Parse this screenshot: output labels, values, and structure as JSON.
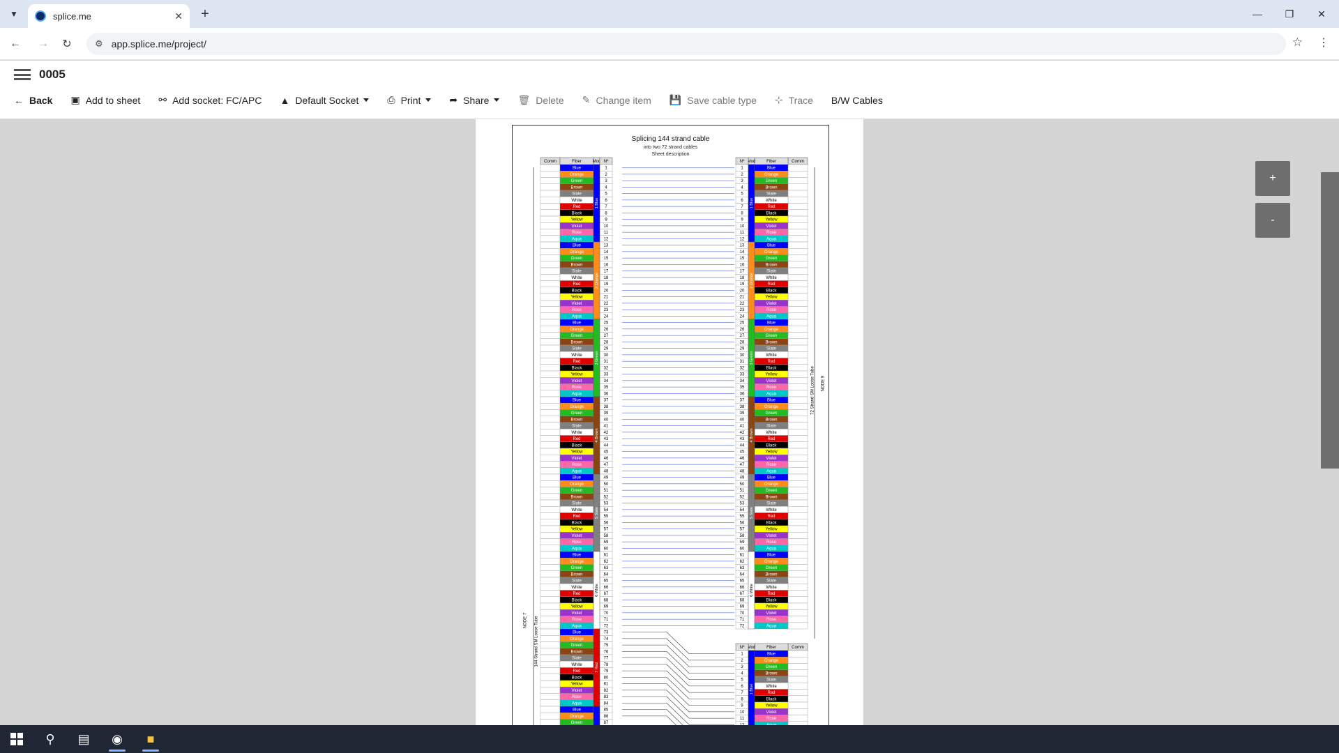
{
  "browser": {
    "tab_title": "splice.me",
    "url": "app.splice.me/project/"
  },
  "app": {
    "title": "0005",
    "actions": {
      "back": "Back",
      "add_to_sheet": "Add to sheet",
      "add_socket": "Add socket: FC/APC",
      "default_socket": "Default Socket",
      "print": "Print",
      "share": "Share",
      "delete": "Delete",
      "change_item": "Change item",
      "save_cable_type": "Save cable type",
      "trace": "Trace",
      "bw_cables": "B/W Cables"
    }
  },
  "sheet": {
    "title": "Splicing 144 strand cable",
    "subtitle": "into two 72 strand cables",
    "description": "Sheet description",
    "headers": {
      "comm": "Comm",
      "fiber": "Fiber",
      "mod": "Mod",
      "num": "Nº"
    },
    "left_cable_label": "144 Strand SM Loose Tube",
    "left_node_label": "NODE 7",
    "right_cable_label": "72 Strand SM Loose Tube",
    "right_node_label": "NODE 9",
    "fiber_colors": [
      {
        "name": "Blue",
        "bg": "#0000ff",
        "fg": "#ffffff"
      },
      {
        "name": "Orange",
        "bg": "#ff8c1a",
        "fg": "#ffffff"
      },
      {
        "name": "Green",
        "bg": "#22bb22",
        "fg": "#ffffff"
      },
      {
        "name": "Brown",
        "bg": "#8b4513",
        "fg": "#ffffff"
      },
      {
        "name": "Slate",
        "bg": "#808080",
        "fg": "#ffffff"
      },
      {
        "name": "White",
        "bg": "#ffffff",
        "fg": "#000000"
      },
      {
        "name": "Red",
        "bg": "#e00000",
        "fg": "#ffffff"
      },
      {
        "name": "Black",
        "bg": "#000000",
        "fg": "#ffffff"
      },
      {
        "name": "Yellow",
        "bg": "#ffff00",
        "fg": "#000000"
      },
      {
        "name": "Violet",
        "bg": "#9933cc",
        "fg": "#ffffff"
      },
      {
        "name": "Rose",
        "bg": "#ff66aa",
        "fg": "#ffffff"
      },
      {
        "name": "Aqua",
        "bg": "#00c8c8",
        "fg": "#ffffff"
      }
    ],
    "modules": [
      {
        "label": "1 Blue",
        "bg": "#0000ff"
      },
      {
        "label": "2 Orange",
        "bg": "#ff8c1a"
      },
      {
        "label": "3 Green",
        "bg": "#22bb22"
      },
      {
        "label": "4 Brown",
        "bg": "#8b4513"
      },
      {
        "label": "5 Slate",
        "bg": "#808080"
      },
      {
        "label": "6 White",
        "bg": "#ffffff"
      },
      {
        "label": "7 Red",
        "bg": "#e00000"
      }
    ],
    "left_rows_visible": 87,
    "right_top_rows": 72,
    "right_bottom_rows_visible": 12
  },
  "zoom": {
    "plus": "+",
    "minus": "-"
  }
}
